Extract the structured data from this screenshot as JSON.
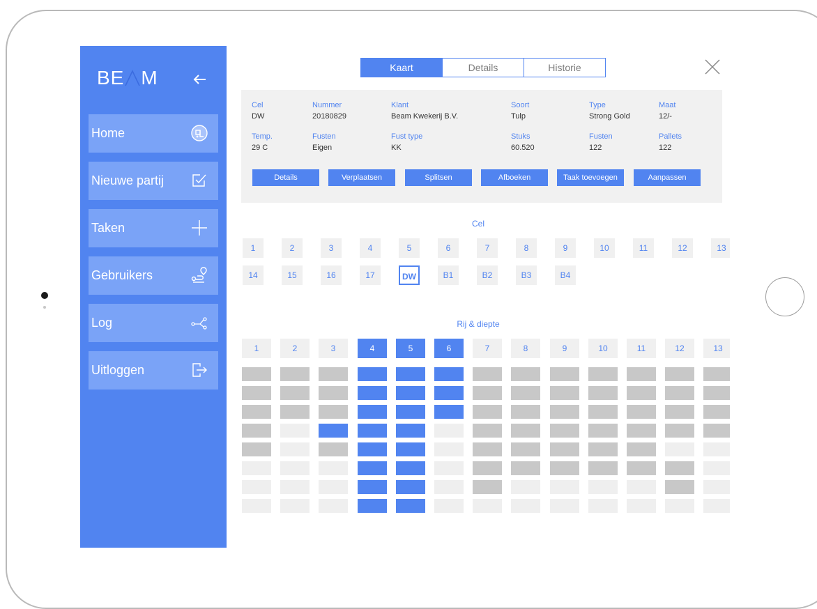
{
  "app": {
    "brand": "BE M",
    "brand_left": "BE",
    "brand_right": "M"
  },
  "sidebar": {
    "items": [
      {
        "label": "Home",
        "icon": "forklift-icon"
      },
      {
        "label": "Nieuwe partij",
        "icon": "checkbox-edit-icon"
      },
      {
        "label": "Taken",
        "icon": "plus-icon"
      },
      {
        "label": "Gebruikers",
        "icon": "route-pin-icon"
      },
      {
        "label": "Log",
        "icon": "share-icon"
      },
      {
        "label": "Uitloggen",
        "icon": "logout-icon"
      }
    ]
  },
  "tabs": [
    {
      "label": "Kaart",
      "active": true
    },
    {
      "label": "Details",
      "active": false
    },
    {
      "label": "Historie",
      "active": false
    }
  ],
  "info": {
    "row1": [
      {
        "key": "Cel",
        "value": "DW"
      },
      {
        "key": "Nummer",
        "value": "20180829"
      },
      {
        "key": "Klant",
        "value": "Beam Kwekerij B.V."
      },
      {
        "key": "Soort",
        "value": "Tulp"
      },
      {
        "key": "Type",
        "value": "Strong Gold"
      },
      {
        "key": "Maat",
        "value": "12/-"
      }
    ],
    "row2": [
      {
        "key": "Temp.",
        "value": "29 C"
      },
      {
        "key": "Fusten",
        "value": "Eigen"
      },
      {
        "key": "Fust type",
        "value": "KK"
      },
      {
        "key": "Stuks",
        "value": "60.520"
      },
      {
        "key": "Fusten",
        "value": "122"
      },
      {
        "key": "Pallets",
        "value": "122"
      }
    ]
  },
  "actions": [
    "Details",
    "Verplaatsen",
    "Splitsen",
    "Afboeken",
    "Taak toevoegen",
    "Aanpassen"
  ],
  "cel_section": {
    "title": "Cel",
    "row1": [
      "1",
      "2",
      "3",
      "4",
      "5",
      "6",
      "7",
      "8",
      "9",
      "10",
      "11",
      "12",
      "13"
    ],
    "row2": [
      "14",
      "15",
      "16",
      "17",
      "DW",
      "B1",
      "B2",
      "B3",
      "B4"
    ],
    "selected": "DW"
  },
  "rij_section": {
    "title": "Rij & diepte",
    "columns": [
      "1",
      "2",
      "3",
      "4",
      "5",
      "6",
      "7",
      "8",
      "9",
      "10",
      "11",
      "12",
      "13"
    ],
    "active_columns": [
      "4",
      "5",
      "6"
    ],
    "grid_legend": {
      "d": "#c8c8c8",
      "l": "#efefef",
      "b": "#5184f0"
    },
    "grid": [
      "dddbbbddddddd",
      "dddbbbddddddd",
      "dddbbbddddddd",
      "dlbbblddddddd",
      "dldbbldddddlw",
      "lllbblddddddl",
      "lllbbldlllldl",
      "lllbblllllllll"
    ]
  },
  "colors": {
    "accent": "#5184f0",
    "sidebar_item": "#7aa3f7",
    "panel": "#f1f1f1"
  }
}
